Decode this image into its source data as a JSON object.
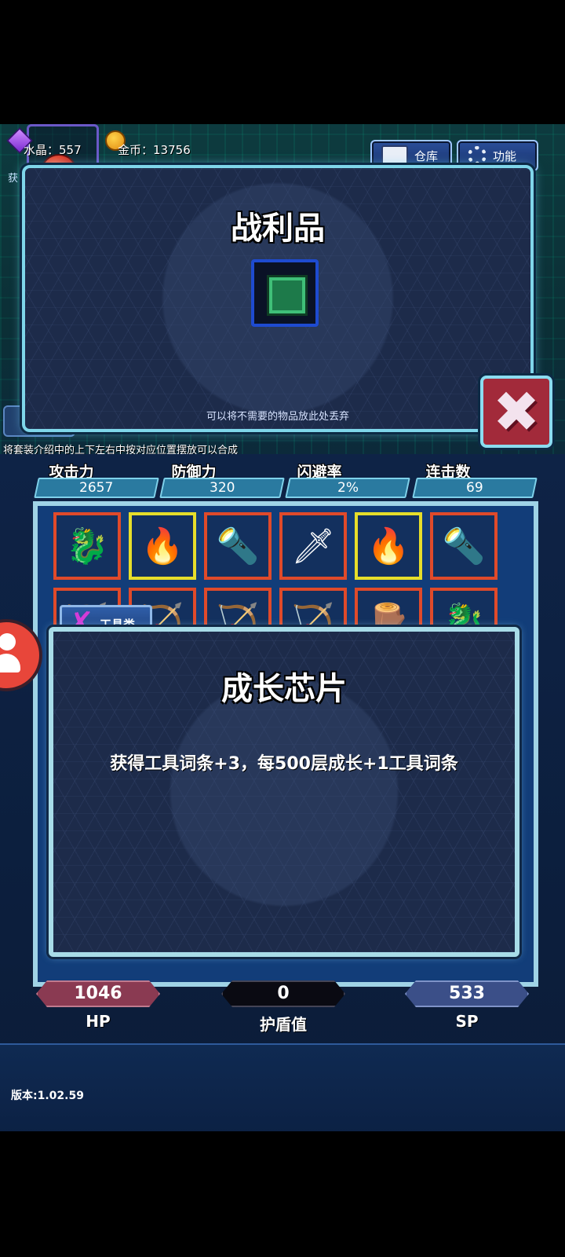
{
  "resources": {
    "crystal_label": "水晶：",
    "crystal_value": "557",
    "gold_label": "金币：",
    "gold_value": "13756"
  },
  "top_buttons": {
    "warehouse": "仓库",
    "function": "功能"
  },
  "loot_panel": {
    "title": "战利品",
    "hint": "可以将不需要的物品放此处丢弃"
  },
  "merge_hint": "将套装介绍中的上下左右中按对应位置摆放可以合成",
  "stats": [
    {
      "name": "攻击力",
      "value": "2657"
    },
    {
      "name": "防御力",
      "value": "320"
    },
    {
      "name": "闪避率",
      "value": "2%"
    },
    {
      "name": "连击数",
      "value": "69"
    }
  ],
  "inventory_row1": [
    {
      "icon": "golden-dragon-statue-icon",
      "glyph": "🐉",
      "frame": "red"
    },
    {
      "icon": "fire-arrow-icon",
      "glyph": "🔥",
      "frame": "yellow"
    },
    {
      "icon": "torch-icon",
      "glyph": "🔦",
      "frame": "red"
    },
    {
      "icon": "flame-sword-icon",
      "glyph": "🗡",
      "frame": "red"
    },
    {
      "icon": "fire-arrow-icon",
      "glyph": "🔥",
      "frame": "yellow"
    },
    {
      "icon": "torch-icon",
      "glyph": "🔦",
      "frame": "red"
    }
  ],
  "inventory_row2": [
    {
      "icon": "bow-icon",
      "glyph": "🏹",
      "frame": "red"
    },
    {
      "icon": "bow-icon",
      "glyph": "🏹",
      "frame": "red"
    },
    {
      "icon": "bow-icon",
      "glyph": "🏹",
      "frame": "red"
    },
    {
      "icon": "bow-icon",
      "glyph": "🏹",
      "frame": "red"
    },
    {
      "icon": "club-icon",
      "glyph": "🪵",
      "frame": "red"
    },
    {
      "icon": "golden-dragon-statue-icon",
      "glyph": "🐉",
      "frame": "red"
    }
  ],
  "tool_tab": "工具类",
  "detail": {
    "title": "成长芯片",
    "description": "获得工具词条+3，每500层成长+1工具词条"
  },
  "bars": {
    "hp_value": "1046",
    "hp_label": "HP",
    "shield_value": "0",
    "shield_label": "护盾值",
    "sp_value": "533",
    "sp_label": "SP"
  },
  "version": "版本:1.02.59",
  "colors": {
    "hp_bar": "#8a3a52",
    "shield_bar": "#0a0a12",
    "sp_bar": "#3b4f88",
    "close_button": "#a22a3a"
  }
}
